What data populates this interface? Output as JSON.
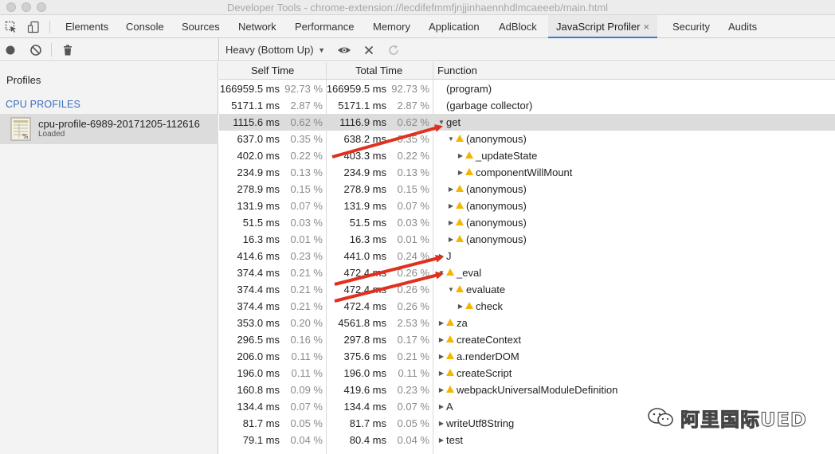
{
  "window": {
    "title": "Developer Tools - chrome-extension://lecdifefmmfjnjjinhaennhdlmcaeeeb/main.html"
  },
  "tabs": [
    {
      "label": "Elements",
      "active": false
    },
    {
      "label": "Console",
      "active": false
    },
    {
      "label": "Sources",
      "active": false
    },
    {
      "label": "Network",
      "active": false
    },
    {
      "label": "Performance",
      "active": false
    },
    {
      "label": "Memory",
      "active": false
    },
    {
      "label": "Application",
      "active": false
    },
    {
      "label": "AdBlock",
      "active": false
    },
    {
      "label": "JavaScript Profiler",
      "active": true,
      "close": "×"
    },
    {
      "label": "Security",
      "active": false
    },
    {
      "label": "Audits",
      "active": false
    }
  ],
  "toolbar": {
    "view_mode": "Heavy (Bottom Up)",
    "record_icon": "record-icon",
    "clear_icon": "clear-icon",
    "trash_icon": "trash-icon",
    "focus_icon": "eye-icon",
    "exclude_icon": "close-icon",
    "restore_icon": "reload-icon"
  },
  "sidebar": {
    "heading": "Profiles",
    "section": "CPU PROFILES",
    "profile": {
      "name": "cpu-profile-6989-20171205-112616",
      "status": "Loaded"
    }
  },
  "grid": {
    "headers": {
      "self": "Self Time",
      "total": "Total Time",
      "function": "Function"
    },
    "rows": [
      {
        "self_ms": "166959.5 ms",
        "self_pct": "92.73 %",
        "total_ms": "166959.5 ms",
        "total_pct": "92.73 %",
        "fn": "(program)",
        "depth": 0,
        "toggle": "",
        "warn": false,
        "selected": false
      },
      {
        "self_ms": "5171.1 ms",
        "self_pct": "2.87 %",
        "total_ms": "5171.1 ms",
        "total_pct": "2.87 %",
        "fn": "(garbage collector)",
        "depth": 0,
        "toggle": "",
        "warn": false,
        "selected": false
      },
      {
        "self_ms": "1115.6 ms",
        "self_pct": "0.62 %",
        "total_ms": "1116.9 ms",
        "total_pct": "0.62 %",
        "fn": "get",
        "depth": 0,
        "toggle": "▼",
        "warn": false,
        "selected": true
      },
      {
        "self_ms": "637.0 ms",
        "self_pct": "0.35 %",
        "total_ms": "638.2 ms",
        "total_pct": "0.35 %",
        "fn": "(anonymous)",
        "depth": 1,
        "toggle": "▼",
        "warn": true,
        "selected": false
      },
      {
        "self_ms": "402.0 ms",
        "self_pct": "0.22 %",
        "total_ms": "403.3 ms",
        "total_pct": "0.22 %",
        "fn": "_updateState",
        "depth": 2,
        "toggle": "▶",
        "warn": true,
        "selected": false
      },
      {
        "self_ms": "234.9 ms",
        "self_pct": "0.13 %",
        "total_ms": "234.9 ms",
        "total_pct": "0.13 %",
        "fn": "componentWillMount",
        "depth": 2,
        "toggle": "▶",
        "warn": true,
        "selected": false
      },
      {
        "self_ms": "278.9 ms",
        "self_pct": "0.15 %",
        "total_ms": "278.9 ms",
        "total_pct": "0.15 %",
        "fn": "(anonymous)",
        "depth": 1,
        "toggle": "▶",
        "warn": true,
        "selected": false
      },
      {
        "self_ms": "131.9 ms",
        "self_pct": "0.07 %",
        "total_ms": "131.9 ms",
        "total_pct": "0.07 %",
        "fn": "(anonymous)",
        "depth": 1,
        "toggle": "▶",
        "warn": true,
        "selected": false
      },
      {
        "self_ms": "51.5 ms",
        "self_pct": "0.03 %",
        "total_ms": "51.5 ms",
        "total_pct": "0.03 %",
        "fn": "(anonymous)",
        "depth": 1,
        "toggle": "▶",
        "warn": true,
        "selected": false
      },
      {
        "self_ms": "16.3 ms",
        "self_pct": "0.01 %",
        "total_ms": "16.3 ms",
        "total_pct": "0.01 %",
        "fn": "(anonymous)",
        "depth": 1,
        "toggle": "▶",
        "warn": true,
        "selected": false
      },
      {
        "self_ms": "414.6 ms",
        "self_pct": "0.23 %",
        "total_ms": "441.0 ms",
        "total_pct": "0.24 %",
        "fn": "J",
        "depth": 0,
        "toggle": "▶",
        "warn": false,
        "selected": false
      },
      {
        "self_ms": "374.4 ms",
        "self_pct": "0.21 %",
        "total_ms": "472.4 ms",
        "total_pct": "0.26 %",
        "fn": "_eval",
        "depth": 0,
        "toggle": "▼",
        "warn": true,
        "selected": false
      },
      {
        "self_ms": "374.4 ms",
        "self_pct": "0.21 %",
        "total_ms": "472.4 ms",
        "total_pct": "0.26 %",
        "fn": "evaluate",
        "depth": 1,
        "toggle": "▼",
        "warn": true,
        "selected": false
      },
      {
        "self_ms": "374.4 ms",
        "self_pct": "0.21 %",
        "total_ms": "472.4 ms",
        "total_pct": "0.26 %",
        "fn": "check",
        "depth": 2,
        "toggle": "▶",
        "warn": true,
        "selected": false
      },
      {
        "self_ms": "353.0 ms",
        "self_pct": "0.20 %",
        "total_ms": "4561.8 ms",
        "total_pct": "2.53 %",
        "fn": "za",
        "depth": 0,
        "toggle": "▶",
        "warn": true,
        "selected": false
      },
      {
        "self_ms": "296.5 ms",
        "self_pct": "0.16 %",
        "total_ms": "297.8 ms",
        "total_pct": "0.17 %",
        "fn": "createContext",
        "depth": 0,
        "toggle": "▶",
        "warn": true,
        "selected": false
      },
      {
        "self_ms": "206.0 ms",
        "self_pct": "0.11 %",
        "total_ms": "375.6 ms",
        "total_pct": "0.21 %",
        "fn": "a.renderDOM",
        "depth": 0,
        "toggle": "▶",
        "warn": true,
        "selected": false
      },
      {
        "self_ms": "196.0 ms",
        "self_pct": "0.11 %",
        "total_ms": "196.0 ms",
        "total_pct": "0.11 %",
        "fn": "createScript",
        "depth": 0,
        "toggle": "▶",
        "warn": true,
        "selected": false
      },
      {
        "self_ms": "160.8 ms",
        "self_pct": "0.09 %",
        "total_ms": "419.6 ms",
        "total_pct": "0.23 %",
        "fn": "webpackUniversalModuleDefinition",
        "depth": 0,
        "toggle": "▶",
        "warn": true,
        "selected": false
      },
      {
        "self_ms": "134.4 ms",
        "self_pct": "0.07 %",
        "total_ms": "134.4 ms",
        "total_pct": "0.07 %",
        "fn": "A",
        "depth": 0,
        "toggle": "▶",
        "warn": false,
        "selected": false
      },
      {
        "self_ms": "81.7 ms",
        "self_pct": "0.05 %",
        "total_ms": "81.7 ms",
        "total_pct": "0.05 %",
        "fn": "writeUtf8String",
        "depth": 0,
        "toggle": "▶",
        "warn": false,
        "selected": false
      },
      {
        "self_ms": "79.1 ms",
        "self_pct": "0.04 %",
        "total_ms": "80.4 ms",
        "total_pct": "0.04 %",
        "fn": "test",
        "depth": 0,
        "toggle": "▶",
        "warn": false,
        "selected": false
      }
    ]
  },
  "colors": {
    "accent": "#3879d9",
    "warning": "#f4b400",
    "arrow": "#e0301e",
    "selected_row": "#dcdcdc"
  },
  "watermark": {
    "text": "阿里国际UED",
    "icon": "wechat-icon"
  }
}
